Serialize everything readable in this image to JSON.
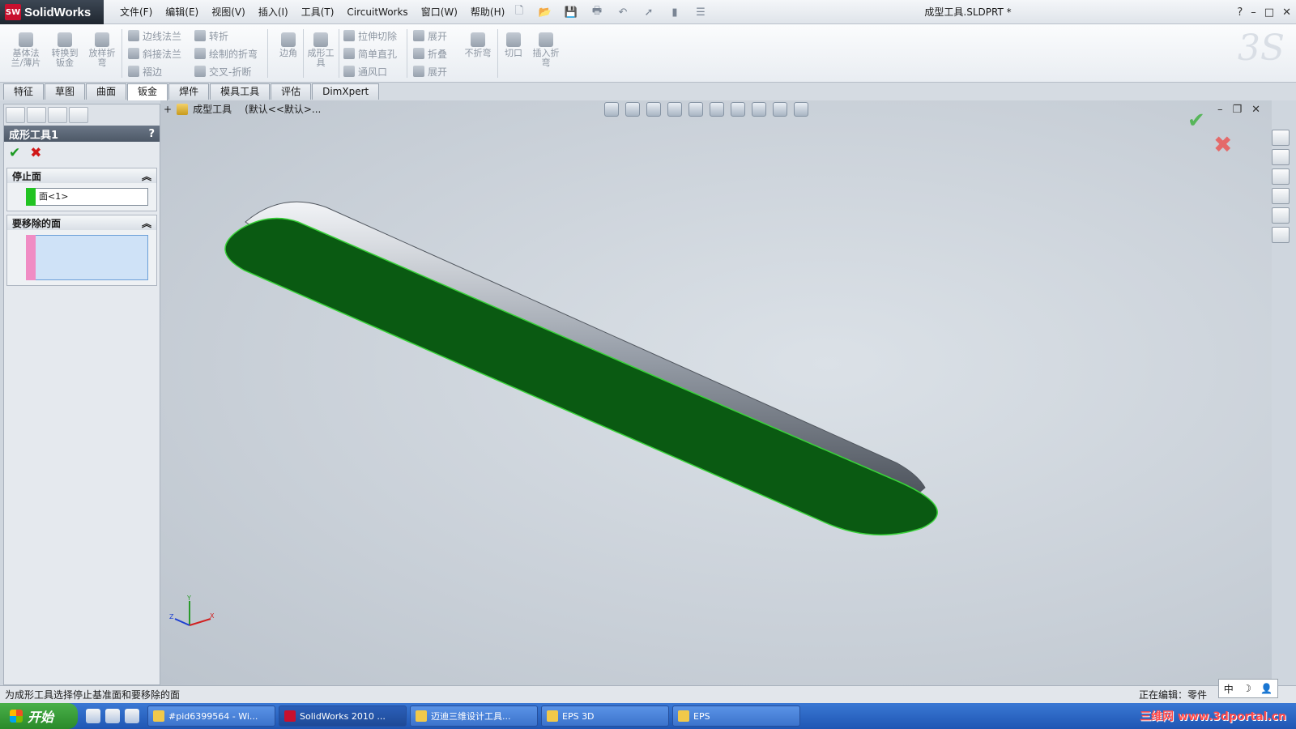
{
  "app": {
    "name": "SolidWorks",
    "mark": "SW"
  },
  "menu": [
    "文件(F)",
    "编辑(E)",
    "视图(V)",
    "插入(I)",
    "工具(T)",
    "CircuitWorks",
    "窗口(W)",
    "帮助(H)"
  ],
  "document_title": "成型工具.SLDPRT *",
  "window_controls": {
    "help": "?",
    "minimize": "–",
    "maximize": "□",
    "close": "✕"
  },
  "commands": {
    "base_flange": "基体法\n兰/薄片",
    "convert_to_sheet": "转换到\n钣金",
    "lofted_bend": "放样折\n弯",
    "edge_flange": "边线法兰",
    "miter_flange": "斜接法兰",
    "hem": "褶边",
    "jog": "转折",
    "sketched_bend": "绘制的折弯",
    "cross_break": "交叉-折断",
    "corners": "边角",
    "forming_tool": "成形工\n具",
    "extruded_cut": "拉伸切除",
    "simple_hole": "简单直孔",
    "vent": "通风口",
    "unfold": "展开",
    "fold": "折叠",
    "flatten": "展开",
    "no_bends": "不折弯",
    "rip": "切口",
    "insert_bends": "插入折\n弯"
  },
  "tabs": [
    "特征",
    "草图",
    "曲面",
    "钣金",
    "焊件",
    "模具工具",
    "评估",
    "DimXpert"
  ],
  "active_tab": "钣金",
  "property_manager": {
    "title": "成形工具1",
    "help": "?",
    "ok": "✔",
    "cancel": "✖",
    "stop_face": {
      "label": "停止面",
      "value": "面<1>",
      "swatch": "#22c322"
    },
    "faces_to_remove": {
      "label": "要移除的面",
      "value": "",
      "swatch": "#f08cc4"
    }
  },
  "graphics": {
    "tree_root": "成型工具",
    "configuration": "(默认<<默认>...",
    "confirm_ok": "✔",
    "confirm_cancel": "✖",
    "model_face_color": "#0a5a12",
    "model_edge_color": "#3ad33a",
    "triad": {
      "x": "X",
      "y": "Y",
      "z": "Z"
    }
  },
  "status": {
    "message": "为成形工具选择停止基准面和要移除的面",
    "editing": "正在编辑：零件"
  },
  "ime": [
    "中",
    "☽",
    "👤"
  ],
  "taskbar": {
    "start": "开始",
    "tasks": [
      "#pid6399564 - Wi...",
      "SolidWorks 2010 ...",
      "迈迪三维设计工具...",
      "EPS 3D",
      "EPS"
    ],
    "active_task": 1,
    "watermark": "三维网 www.3dportal.cn"
  }
}
